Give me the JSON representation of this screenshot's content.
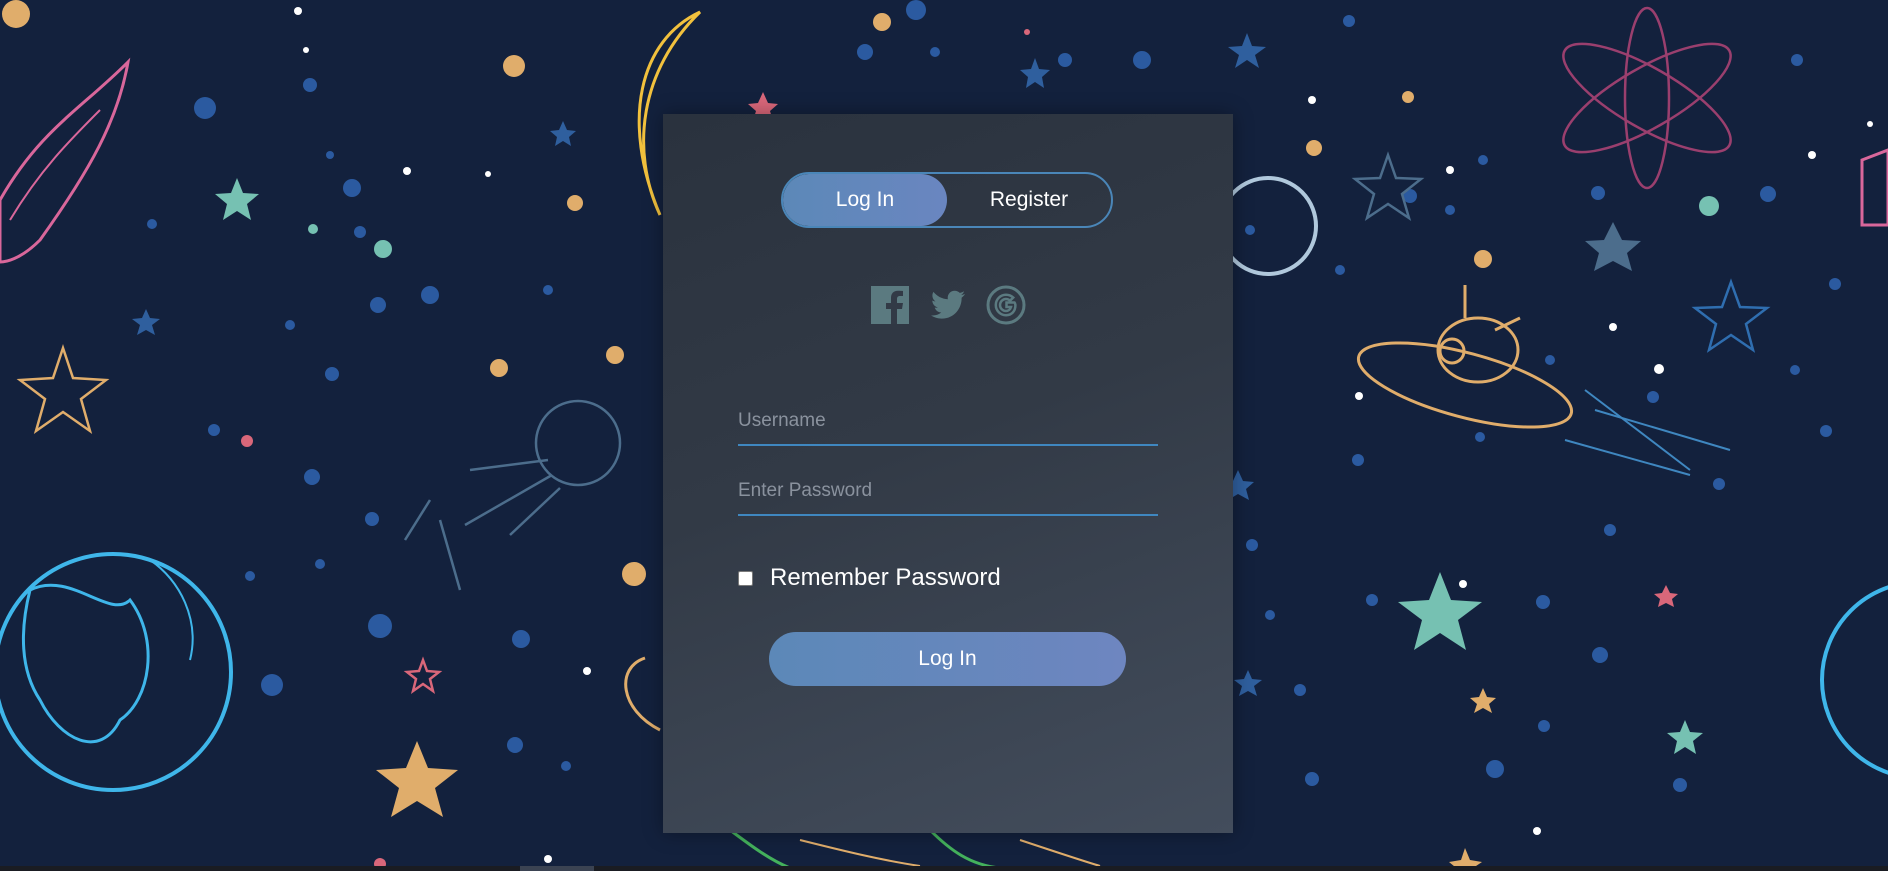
{
  "tabs": {
    "login_label": "Log In",
    "register_label": "Register"
  },
  "social": [
    {
      "icon": "facebook-icon"
    },
    {
      "icon": "twitter-icon"
    },
    {
      "icon": "google-icon"
    }
  ],
  "form": {
    "username_placeholder": "Username",
    "username_value": "",
    "password_placeholder": "Enter Password",
    "password_value": "",
    "remember_label": "Remember Password",
    "remember_checked": false,
    "submit_label": "Log In"
  },
  "colors": {
    "background": "#13213d",
    "accent": "#4a86b8",
    "button_gradient_start": "#5c88b8",
    "button_gradient_end": "#6e86c0",
    "social_icon": "#5b7a80"
  }
}
